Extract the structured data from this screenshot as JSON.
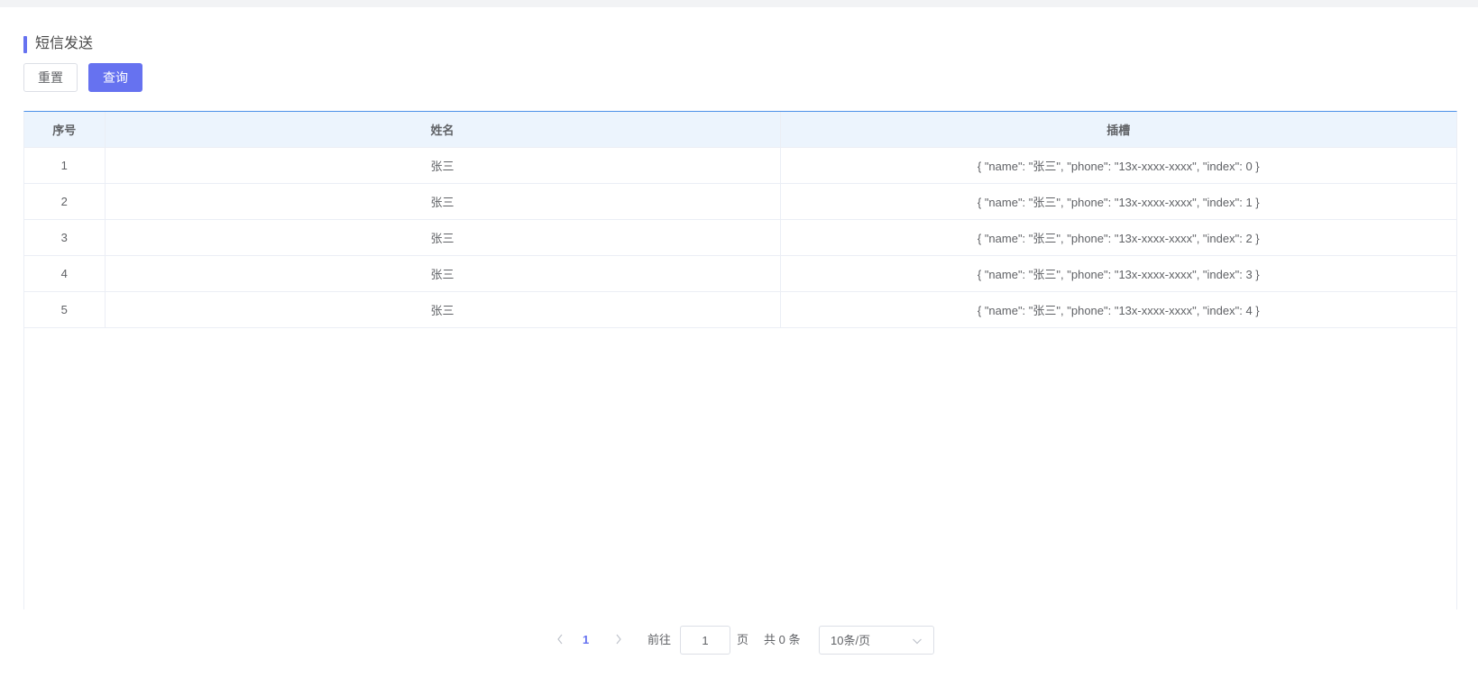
{
  "header": {
    "title": "短信发送"
  },
  "toolbar": {
    "reset_label": "重置",
    "query_label": "查询"
  },
  "table": {
    "columns": [
      "序号",
      "姓名",
      "插槽"
    ],
    "rows": [
      {
        "index": "1",
        "name": "张三",
        "slot": "{ \"name\": \"张三\", \"phone\": \"13x-xxxx-xxxx\", \"index\": 0 }"
      },
      {
        "index": "2",
        "name": "张三",
        "slot": "{ \"name\": \"张三\", \"phone\": \"13x-xxxx-xxxx\", \"index\": 1 }"
      },
      {
        "index": "3",
        "name": "张三",
        "slot": "{ \"name\": \"张三\", \"phone\": \"13x-xxxx-xxxx\", \"index\": 2 }"
      },
      {
        "index": "4",
        "name": "张三",
        "slot": "{ \"name\": \"张三\", \"phone\": \"13x-xxxx-xxxx\", \"index\": 3 }"
      },
      {
        "index": "5",
        "name": "张三",
        "slot": "{ \"name\": \"张三\", \"phone\": \"13x-xxxx-xxxx\", \"index\": 4 }"
      }
    ]
  },
  "pagination": {
    "prev_icon": "chevron-left-icon",
    "next_icon": "chevron-right-icon",
    "current_page": "1",
    "goto_label": "前往",
    "goto_value": "1",
    "page_label": "页",
    "total_text": "共 0 条",
    "page_size": "10条/页",
    "page_size_icon": "chevron-down-icon"
  },
  "colors": {
    "accent": "#6672f0",
    "header_bg": "#ecf4fd",
    "table_top_border": "#4a8fe8"
  }
}
